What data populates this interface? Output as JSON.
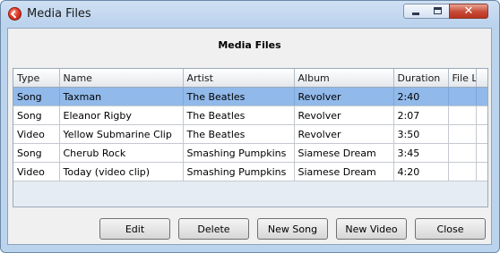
{
  "window": {
    "title": "Media Files",
    "close_symbol": "✕"
  },
  "heading": "Media Files",
  "table": {
    "columns": [
      "Type",
      "Name",
      "Artist",
      "Album",
      "Duration",
      "File L"
    ],
    "rows": [
      [
        "Song",
        "Taxman",
        "The Beatles",
        "Revolver",
        "2:40",
        ""
      ],
      [
        "Song",
        "Eleanor Rigby",
        "The Beatles",
        "Revolver",
        "2:07",
        ""
      ],
      [
        "Video",
        "Yellow Submarine Clip",
        "The Beatles",
        "Revolver",
        "3:50",
        ""
      ],
      [
        "Song",
        "Cherub Rock",
        "Smashing Pumpkins",
        "Siamese Dream",
        "3:45",
        ""
      ],
      [
        "Video",
        "Today (video clip)",
        "Smashing Pumpkins",
        "Siamese Dream",
        "4:20",
        ""
      ]
    ],
    "selected_row": 0
  },
  "buttons": {
    "edit": "Edit",
    "delete": "Delete",
    "new_song": "New Song",
    "new_video": "New Video",
    "close": "Close"
  }
}
